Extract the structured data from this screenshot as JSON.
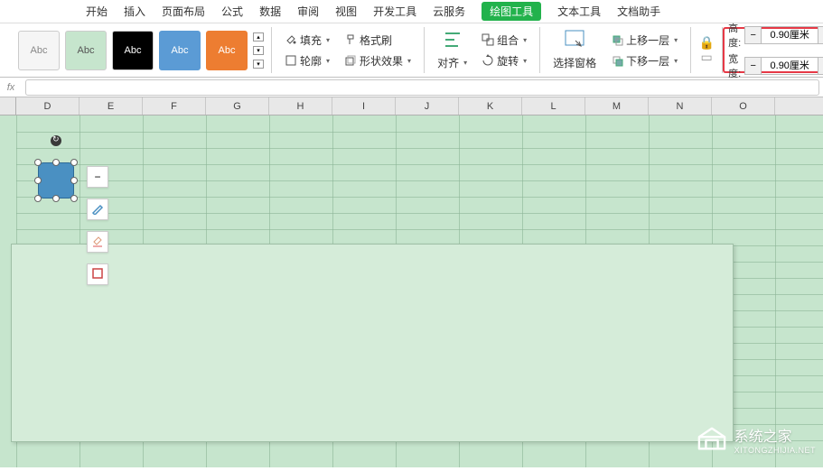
{
  "menu": {
    "items": [
      "开始",
      "插入",
      "页面布局",
      "公式",
      "数据",
      "审阅",
      "视图",
      "开发工具",
      "云服务",
      "绘图工具",
      "文本工具",
      "文档助手"
    ],
    "active_index": 9
  },
  "presets": {
    "label": "Abc"
  },
  "ribbon": {
    "fill": "填充",
    "outline": "轮廓",
    "format_painter": "格式刷",
    "shape_effects": "形状效果",
    "align": "对齐",
    "group": "组合",
    "rotate": "旋转",
    "selection_pane": "选择窗格",
    "bring_forward": "上移一层",
    "send_backward": "下移一层"
  },
  "size": {
    "height_label": "高度:",
    "height_value": "0.90厘米",
    "width_label": "宽度:",
    "width_value": "0.90厘米",
    "minus": "−",
    "plus": "+"
  },
  "columns": [
    "D",
    "E",
    "F",
    "G",
    "H",
    "I",
    "J",
    "K",
    "L",
    "M",
    "N",
    "O"
  ],
  "watermark": {
    "title": "系统之家",
    "sub": "XITONGZHIJIA.NET"
  }
}
